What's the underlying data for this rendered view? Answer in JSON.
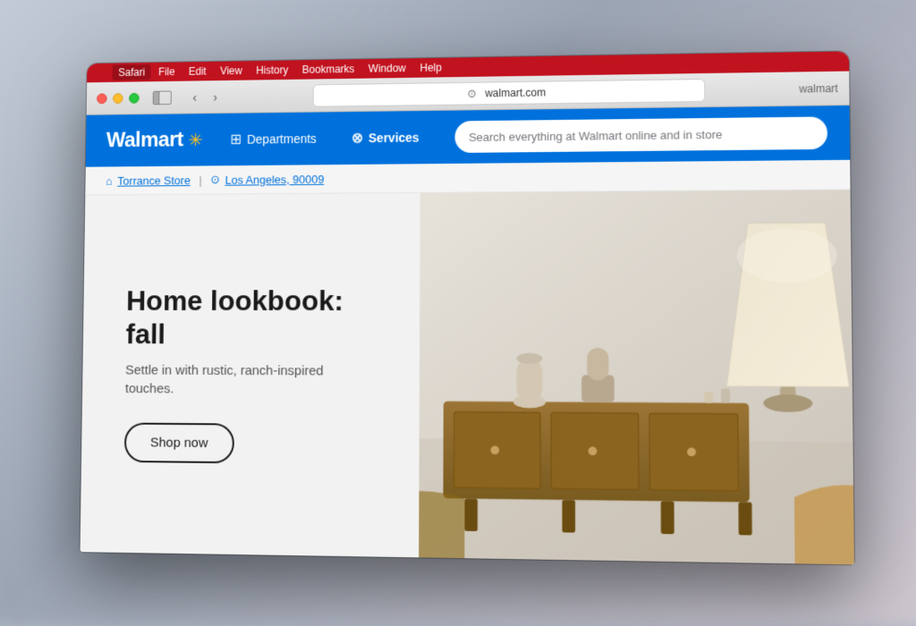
{
  "browser": {
    "menu_bar": {
      "apple_label": "",
      "items": [
        "Safari",
        "File",
        "Edit",
        "View",
        "History",
        "Bookmarks",
        "Window",
        "Help"
      ]
    },
    "toolbar": {
      "back_label": "‹",
      "forward_label": "›",
      "address": "walmart.com"
    },
    "tab": {
      "title": "Walmart"
    }
  },
  "walmart": {
    "logo_text": "Walmart",
    "spark_symbol": "✳",
    "nav": {
      "departments_label": "Departments",
      "services_label": "Services",
      "search_placeholder": "Search everything at Walmart online and in store"
    },
    "sub_nav": {
      "store_label": "Torrance Store",
      "location_label": "Los Angeles, 90009"
    },
    "hero": {
      "title": "Home lookbook: fall",
      "subtitle": "Settle in with rustic, ranch-inspired touches.",
      "cta_label": "Shop now"
    }
  }
}
